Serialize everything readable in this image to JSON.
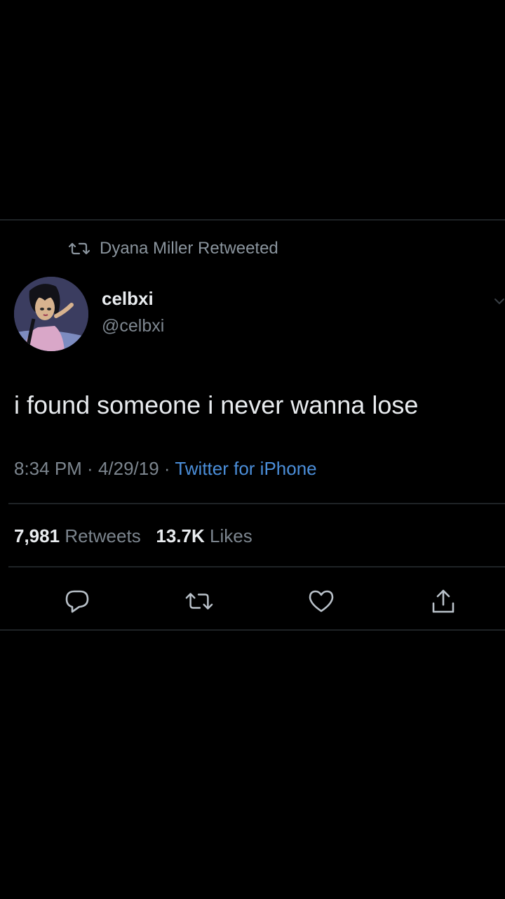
{
  "retweet_context": {
    "text": "Dyana Miller Retweeted",
    "icon": "retweet-icon"
  },
  "author": {
    "display_name": "celbxi",
    "handle": "@celbxi",
    "avatar": "cartoon-girl-avatar"
  },
  "tweet": {
    "text": "i found someone i never wanna lose"
  },
  "meta": {
    "time": "8:34 PM",
    "separator1": " · ",
    "date": "4/29/19",
    "separator2": " · ",
    "source": "Twitter for iPhone"
  },
  "stats": {
    "retweets_count": "7,981",
    "retweets_label": "Retweets",
    "likes_count": "13.7K",
    "likes_label": "Likes"
  },
  "actions": [
    {
      "name": "reply",
      "icon": "reply-icon"
    },
    {
      "name": "retweet",
      "icon": "retweet-icon"
    },
    {
      "name": "like",
      "icon": "heart-icon"
    },
    {
      "name": "share",
      "icon": "share-icon"
    }
  ],
  "colors": {
    "background": "#000000",
    "primary_text": "#e9ecef",
    "secondary_text": "#7c858e",
    "link": "#4b8ed9",
    "divider": "#1f2326"
  }
}
